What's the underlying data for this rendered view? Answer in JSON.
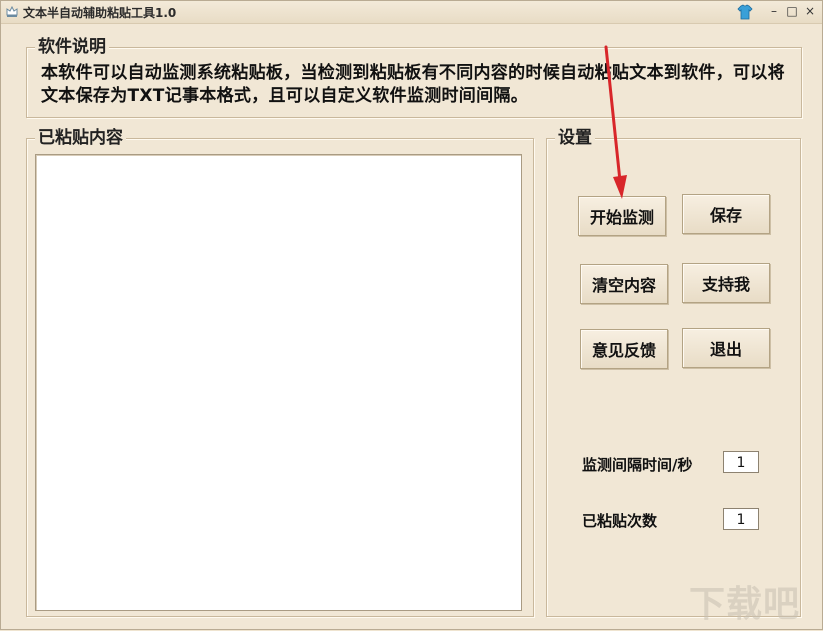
{
  "window": {
    "title": "文本半自动辅助粘贴工具1.0",
    "controls": {
      "minimize": "–",
      "maximize": "□",
      "close": "×"
    }
  },
  "description": {
    "legend": "软件说明",
    "text": "本软件可以自动监测系统粘贴板，当检测到粘贴板有不同内容的时候自动粘贴文本到软件，可以将文本保存为TXT记事本格式，且可以自定义软件监测时间间隔。"
  },
  "pasted_content": {
    "legend": "已粘贴内容",
    "value": ""
  },
  "settings": {
    "legend": "设置",
    "buttons": {
      "start_monitor": "开始监测",
      "save": "保存",
      "clear": "清空内容",
      "support": "支持我",
      "feedback": "意见反馈",
      "exit": "退出"
    },
    "interval_label": "监测间隔时间/秒",
    "interval_value": "1",
    "count_label": "已粘贴次数",
    "count_value": "1"
  },
  "watermark": "下载吧",
  "colors": {
    "window_bg": "#f1e7d5",
    "arrow": "#d8262a"
  }
}
